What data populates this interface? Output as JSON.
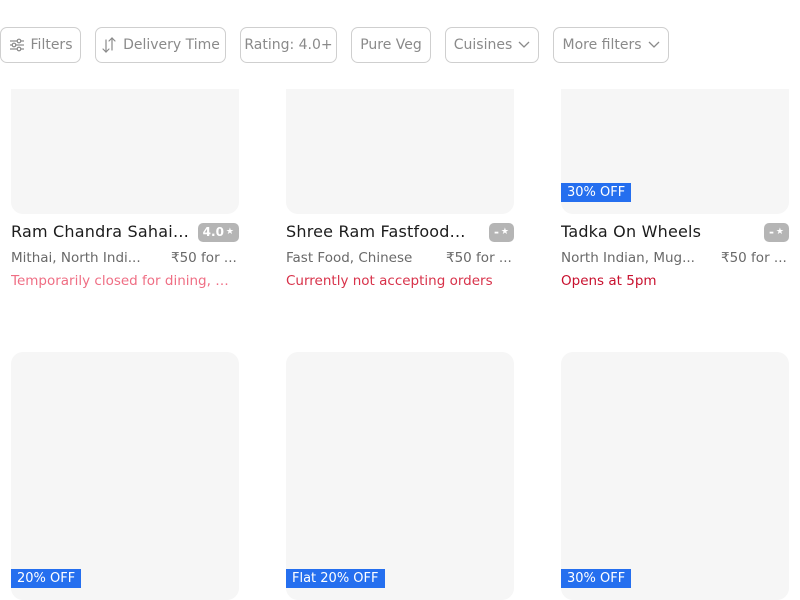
{
  "filters": [
    {
      "label": "Filters",
      "icon": "sliders-icon"
    },
    {
      "label": "Delivery Time",
      "icon": "sort-arrows-icon"
    },
    {
      "label": "Rating: 4.0+"
    },
    {
      "label": "Pure Veg"
    },
    {
      "label": "Cuisines",
      "icon": "chevron-down-icon"
    },
    {
      "label": "More filters",
      "icon": "chevron-down-icon"
    }
  ],
  "restaurants": [
    {
      "name": "Ram Chandra Sahai ...",
      "rating": "4.0",
      "cuisine": "Mithai, North Indi...",
      "price": "₹50 for ...",
      "status": "Temporarily closed for dining, wil...",
      "status_color": "#ef6e84",
      "offer": ""
    },
    {
      "name": "Shree Ram Fastfood...",
      "rating": "-",
      "cuisine": "Fast Food, Chinese",
      "price": "₹50 for ...",
      "status": "Currently not accepting orders",
      "status_color": "#d8324a",
      "offer": ""
    },
    {
      "name": "Tadka On Wheels",
      "rating": "-",
      "cuisine": "North Indian, Mug...",
      "price": "₹50 for ...",
      "status": "Opens at 5pm",
      "status_color": "#c8102e",
      "offer": "30% OFF"
    },
    {
      "offer": "20% OFF"
    },
    {
      "offer": "Flat 20% OFF"
    },
    {
      "offer": "30% OFF"
    }
  ],
  "colors": {
    "offer_bg": "#256fef",
    "rating_bg": "#b5b5b5",
    "placeholder_bg": "#f6f6f6"
  }
}
